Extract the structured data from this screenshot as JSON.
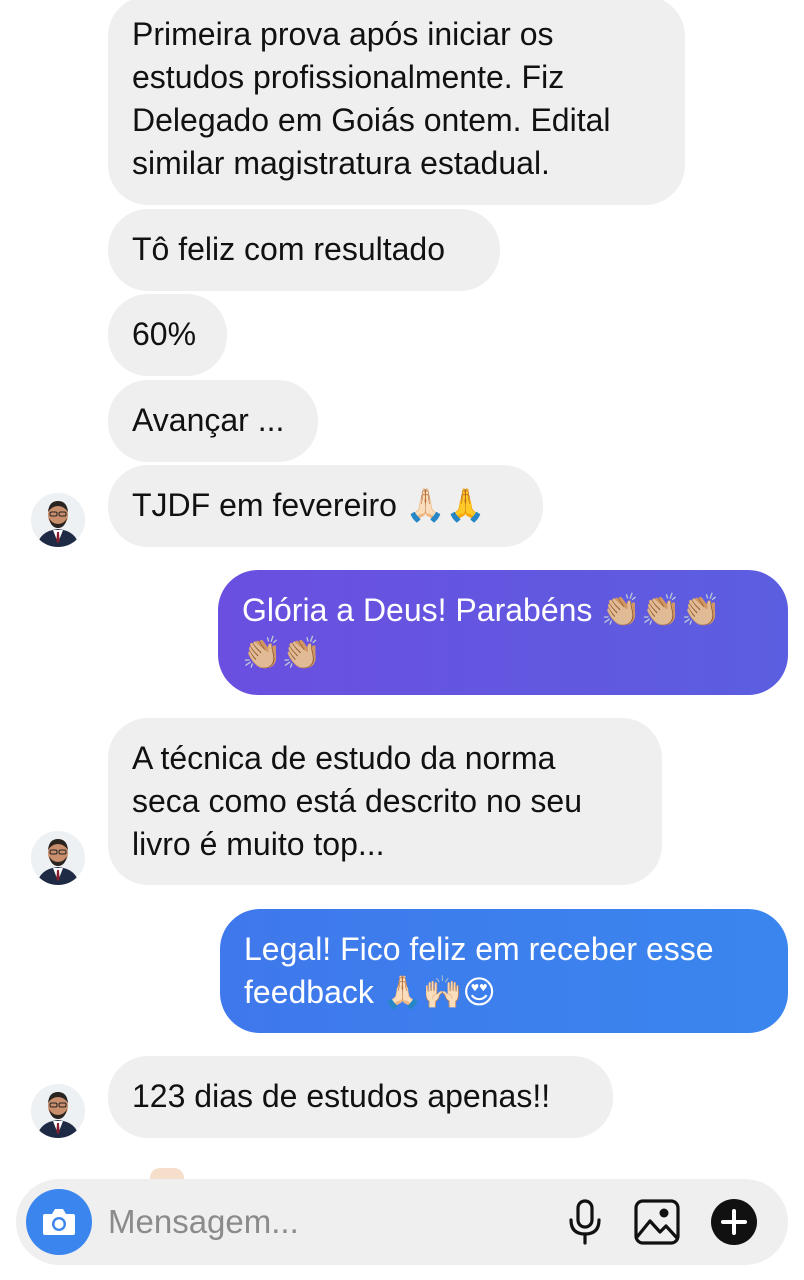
{
  "conversation": {
    "messages": [
      {
        "direction": "incoming",
        "lines": [
          "Primeira prova após iniciar os",
          "estudos profissionalmente. Fiz",
          "Delegado em Goiás ontem. Edital",
          "similar magistratura estadual."
        ]
      },
      {
        "direction": "incoming",
        "lines": [
          "Tô feliz com resultado"
        ]
      },
      {
        "direction": "incoming",
        "lines": [
          "60%"
        ]
      },
      {
        "direction": "incoming",
        "lines": [
          "Avançar ..."
        ]
      },
      {
        "direction": "incoming",
        "lines": [
          "TJDF em fevereiro 🙏🏻🙏"
        ]
      },
      {
        "direction": "outgoing",
        "lines": [
          "Glória a Deus! Parabéns 👏🏼👏🏼👏🏼",
          "👏🏼👏🏼"
        ]
      },
      {
        "direction": "incoming",
        "lines": [
          "A técnica de estudo da norma",
          "seca como está descrito no seu",
          "livro é muito top..."
        ]
      },
      {
        "direction": "outgoing",
        "lines": [
          "Legal! Fico feliz em receber esse",
          "feedback 🙏🏻🙌🏻😍"
        ]
      },
      {
        "direction": "incoming",
        "lines": [
          "123 dias de estudos apenas!!"
        ]
      }
    ]
  },
  "composer": {
    "placeholder": "Mensagem...",
    "camera_icon": "camera-icon",
    "mic_icon": "microphone-icon",
    "gallery_icon": "image-icon",
    "plus_icon": "plus-circle-icon"
  },
  "colors": {
    "incoming_bubble": "#efefef",
    "outgoing_purple": "#6256e0",
    "outgoing_blue": "#3b82ee",
    "camera_button": "#3b86ee"
  }
}
